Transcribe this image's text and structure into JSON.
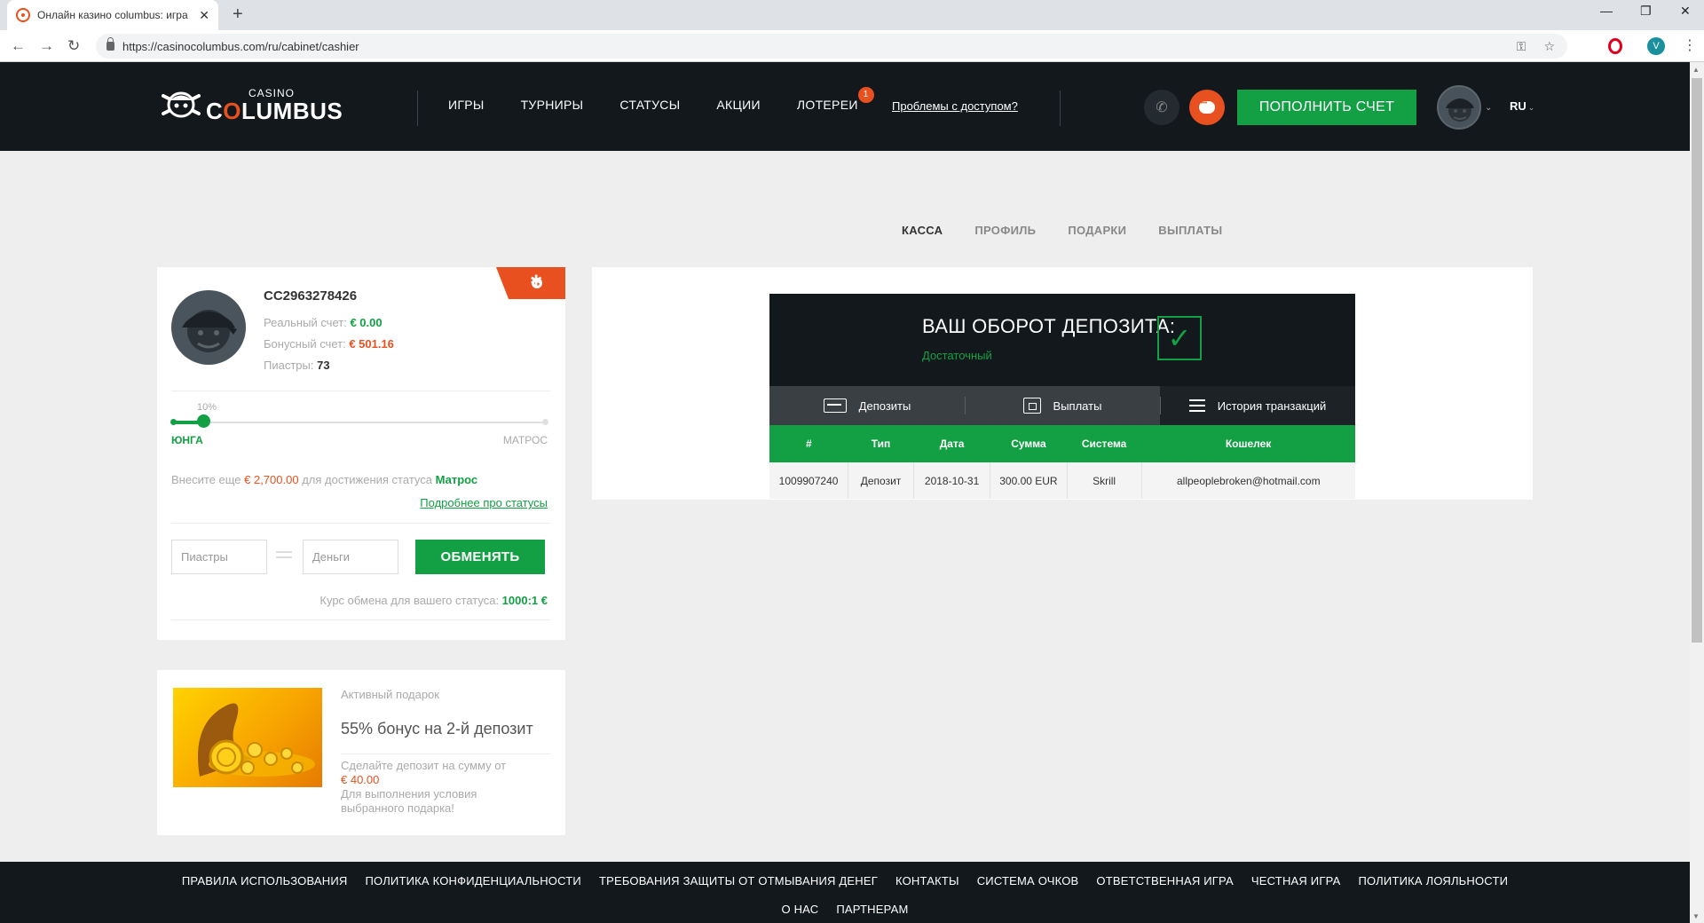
{
  "browser": {
    "tab_title": "Онлайн казино columbus: игра",
    "url": "https://casinocolumbus.com/ru/cabinet/cashier",
    "profile_initial": "V"
  },
  "header": {
    "logo_casino": "CASINO",
    "logo_word_pre": "C",
    "logo_word_o": "O",
    "logo_word_post": "LUMBUS",
    "nav": [
      "ИГРЫ",
      "ТУРНИРЫ",
      "СТАТУСЫ",
      "АКЦИИ",
      "ЛОТЕРЕИ"
    ],
    "lottery_badge": "1",
    "access_link": "Проблемы с доступом?",
    "deposit_button": "ПОПОЛНИТЬ СЧЕТ",
    "language": "RU"
  },
  "cabinet_tabs": [
    "КАССА",
    "ПРОФИЛЬ",
    "ПОДАРКИ",
    "ВЫПЛАТЫ"
  ],
  "profile": {
    "account_id": "CC2963278426",
    "real_label": "Реальный счет:",
    "real_value": "€ 0.00",
    "bonus_label": "Бонусный счет:",
    "bonus_value": "€ 501.16",
    "piastres_label": "Пиастры:",
    "piastres_value": "73",
    "progress_label": "10%",
    "progress_fraction": 0.08,
    "level_current": "ЮНГА",
    "level_next": "МАТРОС",
    "status_msg_pre": "Внесите еще ",
    "status_msg_amount": "€ 2,700.00",
    "status_msg_mid": " для достижения статуса ",
    "status_msg_status": "Матрос",
    "status_link": "Подробнее про статусы",
    "piastres_placeholder": "Пиастры",
    "money_placeholder": "Деньги",
    "exchange_button": "ОБМЕНЯТЬ",
    "rate_label": "Курс обмена для вашего статуса: ",
    "rate_value": "1000:1 €"
  },
  "gift": {
    "label": "Активный подарок",
    "title": "55% бонус на 2-й депозит",
    "condition": "Сделайте депозит на сумму от",
    "amount": "€ 40.00",
    "note": "Для выполнения условия выбранного подарка!"
  },
  "cashier": {
    "turnover_title": "ВАШ ОБОРОТ ДЕПОЗИТА:",
    "turnover_status": "Достаточный",
    "check_mark": "✓",
    "tabs": [
      "Депозиты",
      "Выплаты",
      "История транзакций"
    ],
    "active_tab": 2,
    "columns": [
      "#",
      "Тип",
      "Дата",
      "Сумма",
      "Система",
      "Кошелек"
    ],
    "rows": [
      [
        "1009907240",
        "Депозит",
        "2018-10-31",
        "300.00 EUR",
        "Skrill",
        "allpeoplebroken@hotmail.com"
      ]
    ]
  },
  "footer": {
    "row1": [
      "ПРАВИЛА ИСПОЛЬЗОВАНИЯ",
      "ПОЛИТИКА КОНФИДЕНЦИАЛЬНОСТИ",
      "ТРЕБОВАНИЯ ЗАЩИТЫ ОТ ОТМЫВАНИЯ ДЕНЕГ",
      "КОНТАКТЫ",
      "СИСТЕМА ОЧКОВ",
      "ОТВЕТСТВЕННАЯ ИГРА",
      "ЧЕСТНАЯ ИГРА",
      "ПОЛИТИКА ЛОЯЛЬНОСТИ"
    ],
    "row2": [
      "О НАС",
      "ПАРТНЕРАМ"
    ]
  },
  "colors": {
    "brand_green": "#13a044",
    "brand_orange": "#e8501f",
    "header_dark": "#12181c"
  }
}
